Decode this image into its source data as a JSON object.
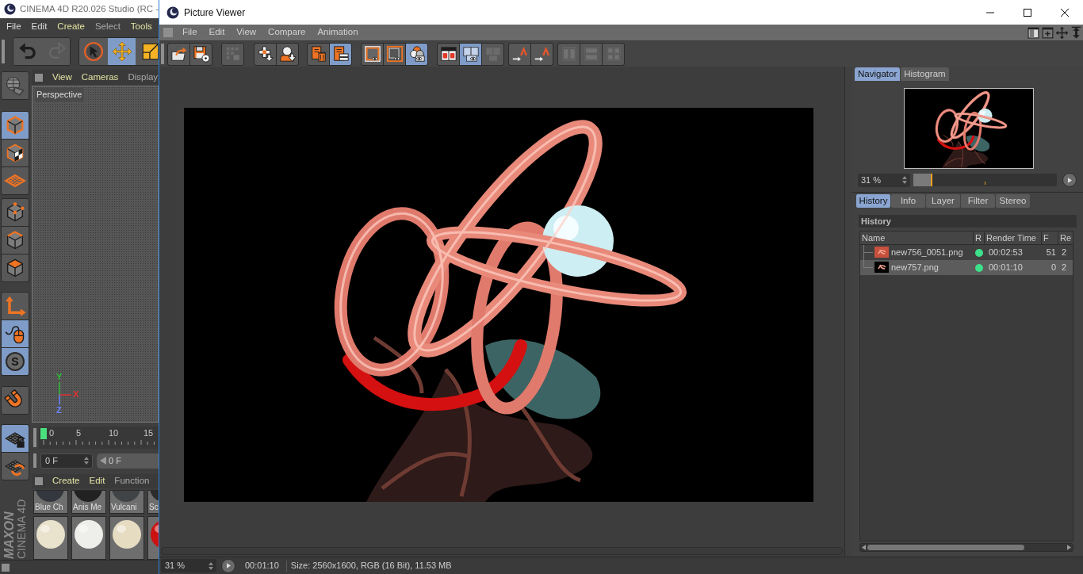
{
  "background_window": {
    "title": "CINEMA 4D R20.026 Studio (RC -",
    "menu": [
      {
        "label": "File",
        "color": "#dcdcdc"
      },
      {
        "label": "Edit",
        "color": "#dcdcdc"
      },
      {
        "label": "Create",
        "color": "#e4e4a4"
      },
      {
        "label": "Select",
        "color": "#a9a9a9"
      },
      {
        "label": "Tools",
        "color": "#e4e4a4"
      }
    ],
    "toolbar": [
      [
        {
          "kind": "undo",
          "selected": false,
          "disabled": false
        },
        {
          "kind": "redo",
          "selected": false,
          "disabled": true
        }
      ],
      [
        {
          "kind": "select",
          "selected": false,
          "disabled": false
        },
        {
          "kind": "move",
          "selected": true,
          "disabled": false
        },
        {
          "kind": "scale",
          "selected": false,
          "disabled": false
        }
      ]
    ],
    "palette": [
      [
        {
          "kind": "make_editable",
          "selected": false
        }
      ],
      [
        {
          "kind": "model",
          "selected": true
        },
        {
          "kind": "texture",
          "selected": false
        },
        {
          "kind": "workplane",
          "selected": false
        }
      ],
      [
        {
          "kind": "points",
          "selected": false
        },
        {
          "kind": "edges",
          "selected": false
        },
        {
          "kind": "polygons",
          "selected": false
        }
      ],
      [
        {
          "kind": "axis",
          "selected": false
        },
        {
          "kind": "tweak",
          "selected": true
        },
        {
          "kind": "solo",
          "selected": true,
          "glyph": "S"
        }
      ],
      [
        {
          "kind": "snap",
          "selected": false
        }
      ],
      [
        {
          "kind": "lock_workplane",
          "selected": true
        },
        {
          "kind": "align_workplane",
          "selected": false
        }
      ]
    ],
    "logo": {
      "brand": "MAXON",
      "product": "CINEMA 4D"
    },
    "viewport": {
      "menu": [
        {
          "label": "View",
          "color": "#e4e4a4"
        },
        {
          "label": "Cameras",
          "color": "#e4e4a4"
        },
        {
          "label": "Display",
          "color": "#a9a9a9"
        }
      ],
      "camera": "Perspective",
      "axes": [
        {
          "label": "Y",
          "color": "#2fbf3a"
        },
        {
          "label": "X",
          "color": "#e03030"
        },
        {
          "label": "Z",
          "color": "#6a86ff"
        }
      ]
    },
    "timeline": {
      "ticks": [
        "0",
        "5",
        "10",
        "15"
      ]
    },
    "frame_fields": {
      "current": "0 F",
      "start": "0 F"
    },
    "materials": {
      "menu": [
        {
          "label": "Create",
          "color": "#e4e4a4"
        },
        {
          "label": "Edit",
          "color": "#e4e4a4"
        },
        {
          "label": "Function",
          "color": "#a9a9a9"
        }
      ],
      "tiles": [
        {
          "name": "Blue Ch",
          "color": "#34383e"
        },
        {
          "name": "Anis Me",
          "color": "#222222"
        },
        {
          "name": "Vulcani",
          "color": "#404446"
        },
        {
          "name": "Sc",
          "color": "#2c2c2c"
        }
      ],
      "tiles_row_2": [
        {
          "color": "#e9e2cc"
        },
        {
          "color": "#eeeeea"
        },
        {
          "color": "#e5dcc2"
        },
        {
          "color": "#cc1111"
        }
      ]
    }
  },
  "picture_viewer": {
    "title": "Picture Viewer",
    "menu": [
      "File",
      "Edit",
      "View",
      "Compare",
      "Animation"
    ],
    "menu_icons": [
      {
        "kind": "layout"
      },
      {
        "kind": "new_panel"
      },
      {
        "kind": "drag"
      },
      {
        "kind": "resize"
      }
    ],
    "toolbar": [
      [
        {
          "kind": "open",
          "selected": false,
          "disabled": false
        },
        {
          "kind": "save",
          "selected": false,
          "disabled": false
        }
      ],
      [
        {
          "kind": "grid",
          "selected": false,
          "disabled": true
        }
      ],
      [
        {
          "kind": "export_grid",
          "selected": false,
          "disabled": false
        },
        {
          "kind": "export_person",
          "selected": false,
          "disabled": false
        }
      ],
      [
        {
          "kind": "delete",
          "selected": false,
          "disabled": false
        },
        {
          "kind": "list",
          "selected": true,
          "disabled": false
        }
      ],
      [
        {
          "kind": "region_a",
          "selected": false,
          "disabled": false
        },
        {
          "kind": "region_b",
          "selected": false,
          "disabled": false
        },
        {
          "kind": "compare",
          "selected": true,
          "disabled": false
        }
      ],
      [
        {
          "kind": "ab_split",
          "selected": false,
          "disabled": false
        },
        {
          "kind": "ab_overlay",
          "selected": true,
          "disabled": false
        },
        {
          "kind": "ab_diff",
          "selected": false,
          "disabled": true
        }
      ],
      [
        {
          "kind": "set_a",
          "selected": false,
          "disabled": false
        },
        {
          "kind": "set_b",
          "selected": false,
          "disabled": false
        }
      ],
      [
        {
          "kind": "swap_h",
          "selected": false,
          "disabled": true
        },
        {
          "kind": "swap_v",
          "selected": false,
          "disabled": true
        },
        {
          "kind": "swap_both",
          "selected": false,
          "disabled": true
        }
      ]
    ],
    "navigator": {
      "tabs": [
        {
          "label": "Navigator",
          "selected": true
        },
        {
          "label": "Histogram",
          "selected": false
        }
      ],
      "zoom": "31 %",
      "zoom_slider": {
        "level": 0.13
      }
    },
    "history": {
      "tabs": [
        {
          "label": "History",
          "selected": true
        },
        {
          "label": "Info",
          "selected": false
        },
        {
          "label": "Layer",
          "selected": false
        },
        {
          "label": "Filter",
          "selected": false
        },
        {
          "label": "Stereo",
          "selected": false
        }
      ],
      "title": "History",
      "columns": [
        "Name",
        "R",
        "Render Time",
        "F",
        "Re"
      ],
      "rows": [
        {
          "name": "new756_0051.png",
          "thumbnail": {
            "color": "#c8503c"
          },
          "status": {
            "color": "#3ee08a"
          },
          "render_time": "00:02:53",
          "frame": "51",
          "column_5": "2",
          "selected": false
        },
        {
          "name": "new757.png",
          "thumbnail": {
            "color": "#000000"
          },
          "status": {
            "color": "#3ee08a"
          },
          "render_time": "00:01:10",
          "frame": "0",
          "column_5": "2",
          "selected": true
        }
      ]
    },
    "status_bar": {
      "zoom": "31 %",
      "time": "00:01:10",
      "info": "Size: 2560x1600, RGB (16 Bit), 11.53 MB"
    }
  }
}
